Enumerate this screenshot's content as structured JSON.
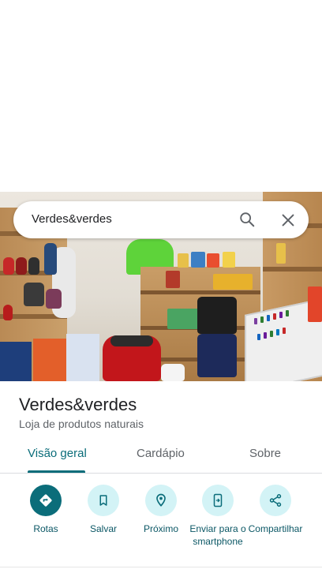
{
  "search": {
    "query": "Verdes&verdes"
  },
  "place": {
    "name": "Verdes&verdes",
    "category": "Loja de produtos naturais"
  },
  "tabs": [
    {
      "label": "Visão geral",
      "active": true
    },
    {
      "label": "Cardápio",
      "active": false
    },
    {
      "label": "Sobre",
      "active": false
    }
  ],
  "actions": [
    {
      "label": "Rotas",
      "icon": "directions-icon",
      "primary": true
    },
    {
      "label": "Salvar",
      "icon": "bookmark-icon",
      "primary": false
    },
    {
      "label": "Próximo",
      "icon": "nearby-icon",
      "primary": false
    },
    {
      "label": "Enviar para o smartphone",
      "icon": "send-to-phone-icon",
      "primary": false
    },
    {
      "label": "Compartilhar",
      "icon": "share-icon",
      "primary": false
    }
  ],
  "colors": {
    "accent": "#0b6d7a",
    "action_bg": "#d3f3f6"
  }
}
